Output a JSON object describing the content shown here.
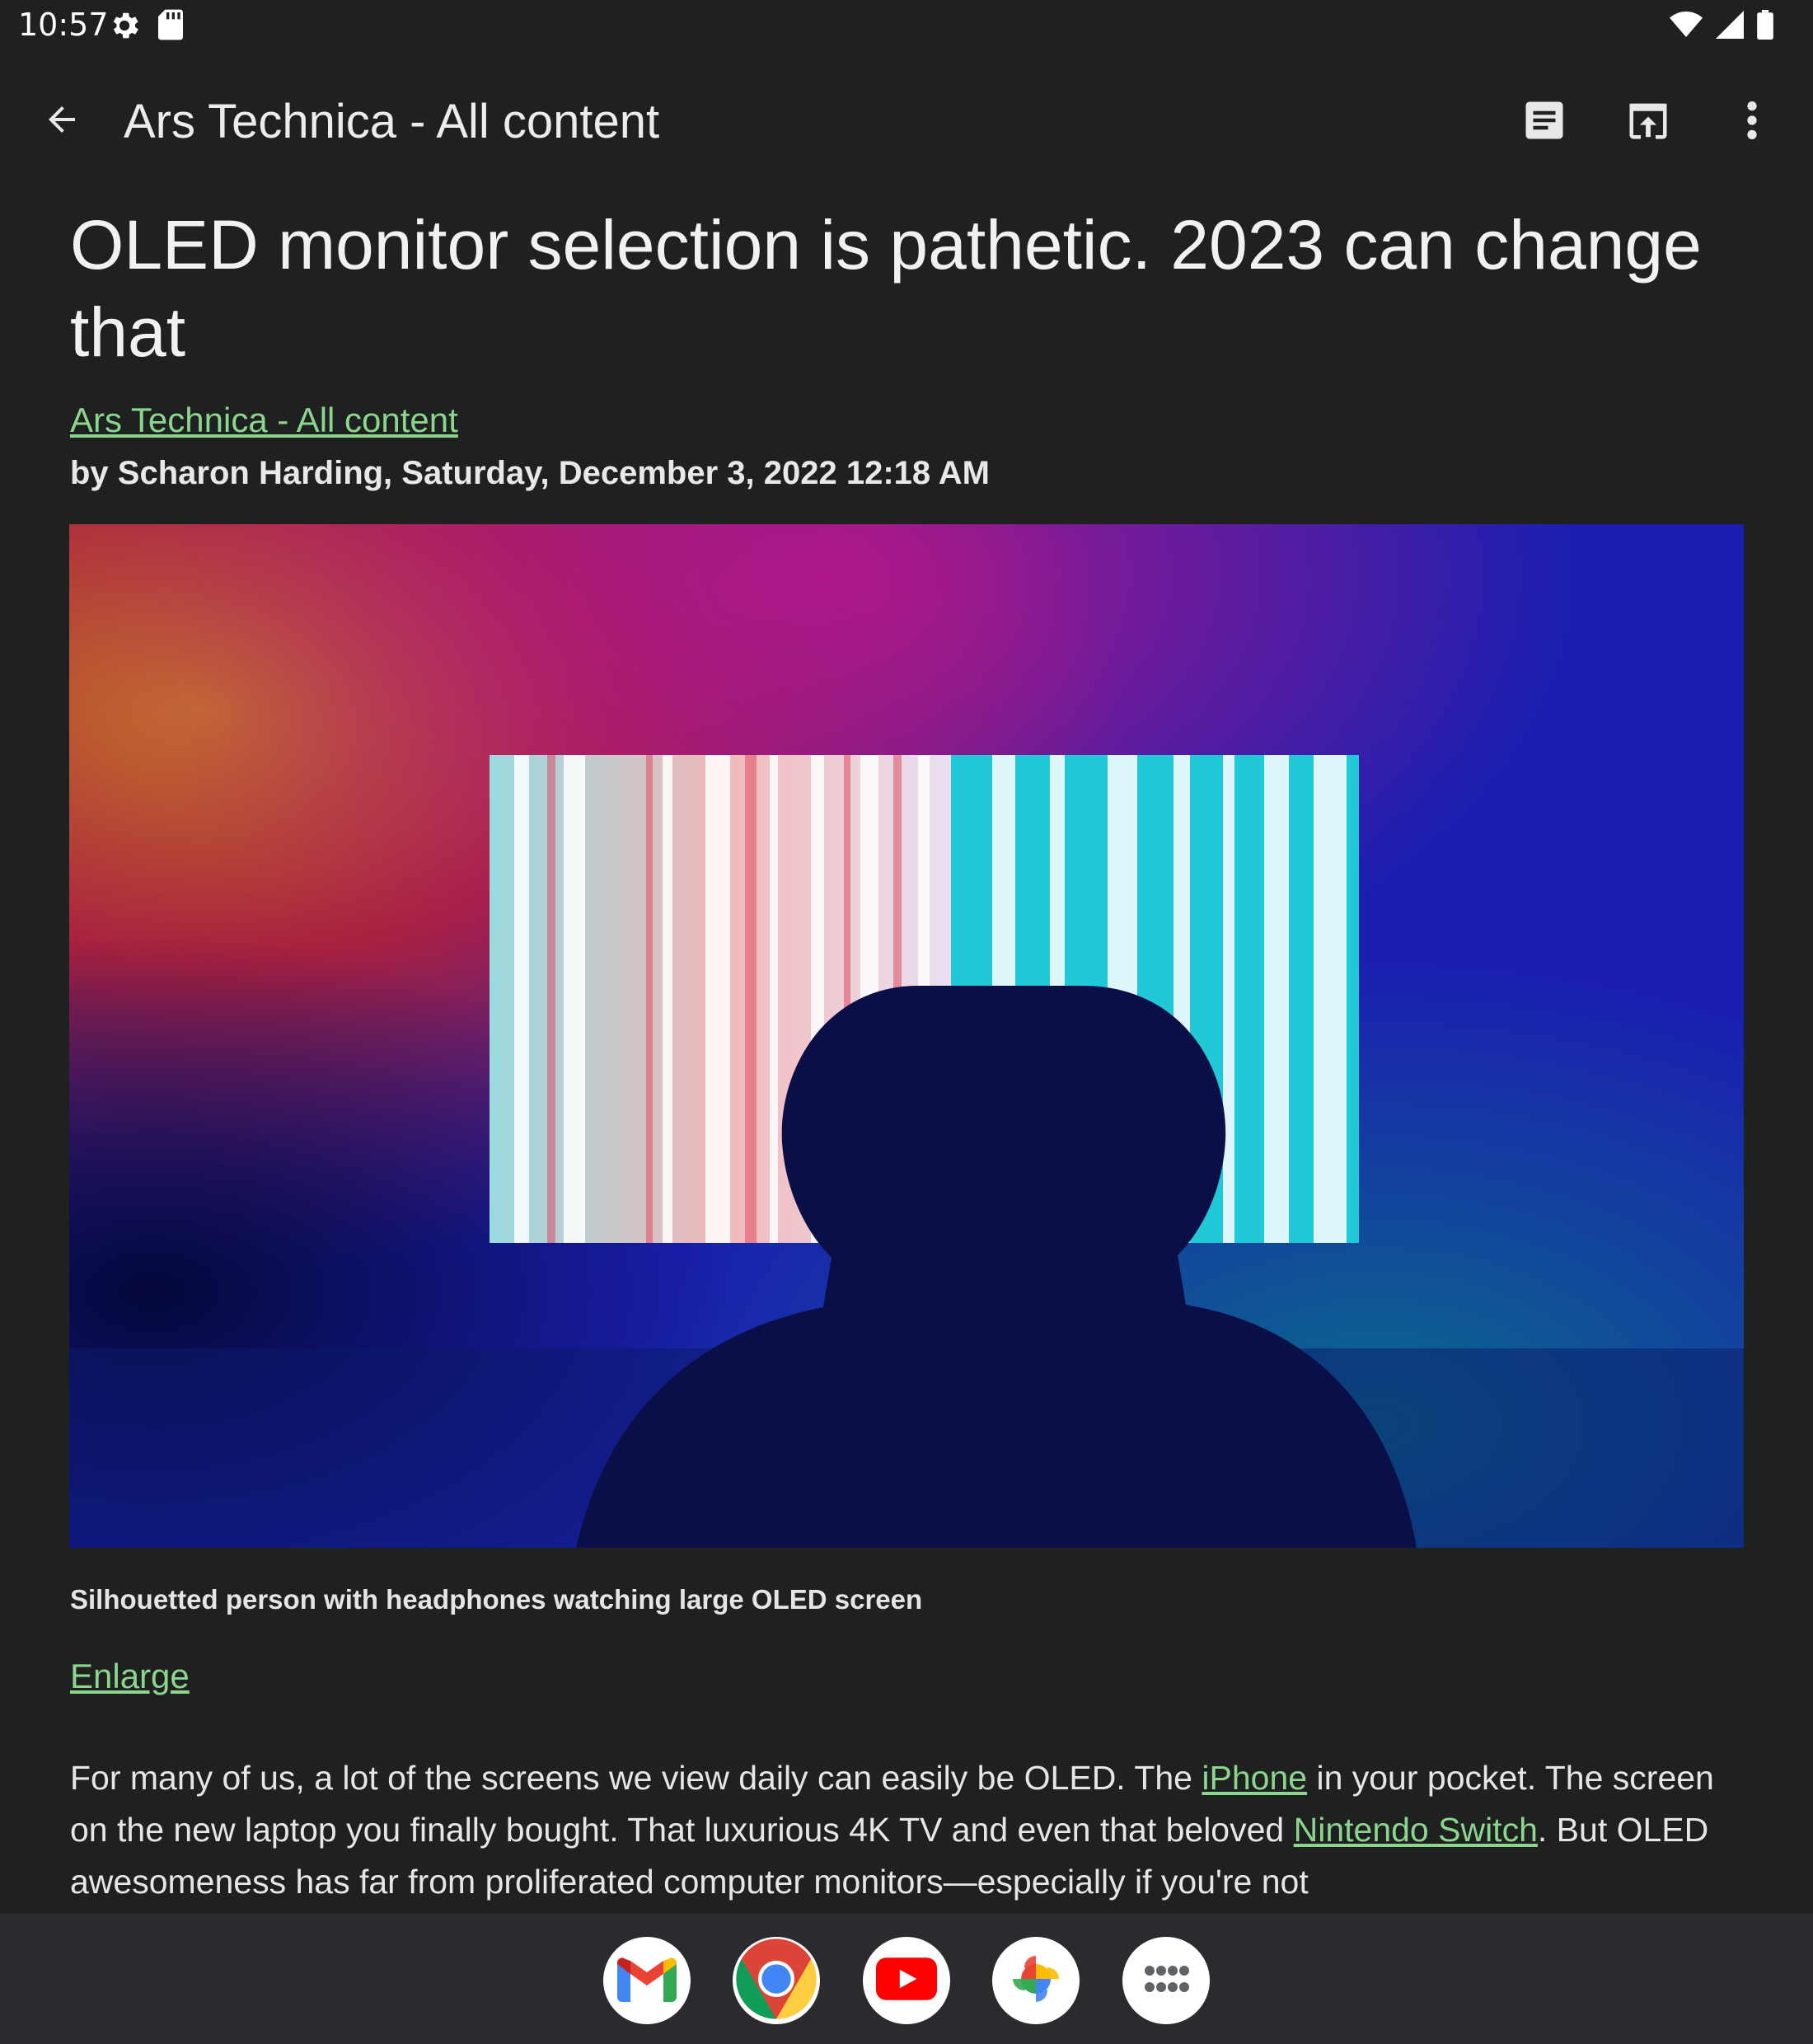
{
  "status_bar": {
    "time": "10:57",
    "left_icons": [
      "settings-gear-icon",
      "sd-card-icon"
    ],
    "right_icons": [
      "wifi-icon",
      "cell-signal-icon",
      "battery-icon"
    ]
  },
  "app_bar": {
    "back_icon": "arrow-left-icon",
    "title": "Ars Technica - All content",
    "actions": [
      "reader-view-icon",
      "open-in-browser-icon",
      "more-vert-icon"
    ]
  },
  "article": {
    "title": "OLED monitor selection is pathetic. 2023 can change that",
    "source": "Ars Technica - All content",
    "byline": "by Scharon Harding, Saturday, December 3, 2022 12:18 AM",
    "image_caption": "Silhouetted person with headphones watching large OLED screen",
    "enlarge_label": "Enlarge",
    "body": {
      "t1": "For many of us, a lot of the screens we view daily can easily be OLED. The ",
      "link1": "iPhone",
      "t2": " in your pocket. The screen on the new laptop you finally bought. That luxurious 4K TV and even that beloved ",
      "link2": "Nintendo Switch",
      "t3": ". But OLED awesomeness has far from proliferated computer monitors—especially if you're not"
    }
  },
  "dock": {
    "apps": [
      "gmail-icon",
      "chrome-icon",
      "youtube-icon",
      "photos-icon",
      "app-drawer-icon"
    ]
  },
  "colors": {
    "background": "#1f2020",
    "link": "#8cd58e",
    "dock": "#2a2b2f"
  }
}
